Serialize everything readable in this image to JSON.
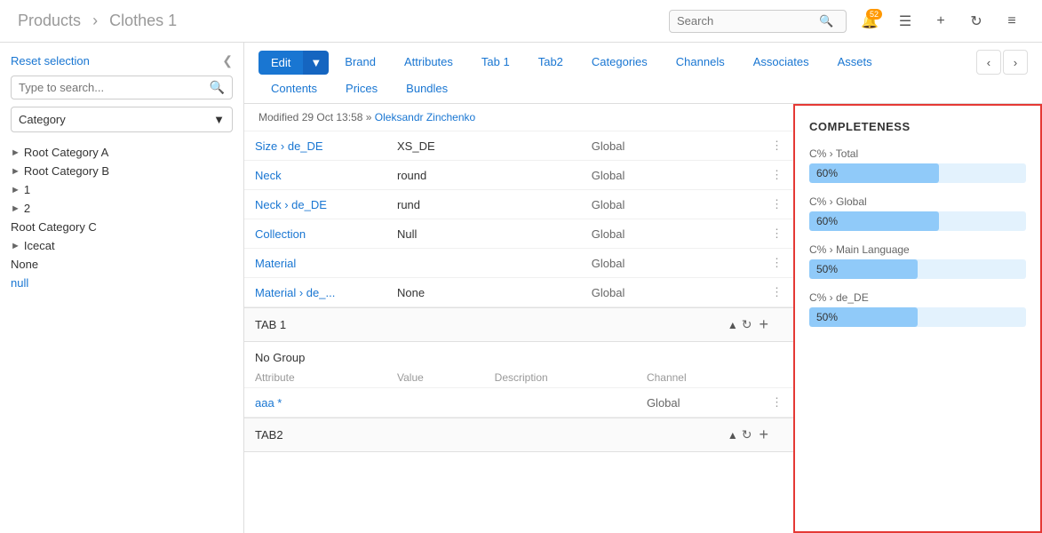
{
  "header": {
    "title": "Products",
    "separator": "›",
    "subtitle": "Clothes 1",
    "search_placeholder": "Search",
    "badge_count": "52"
  },
  "sidebar": {
    "reset_label": "Reset selection",
    "search_placeholder": "Type to search...",
    "dropdown_label": "Category",
    "tree_items": [
      {
        "label": "Root Category A",
        "has_children": true
      },
      {
        "label": "Root Category B",
        "has_children": true
      },
      {
        "label": "1",
        "has_children": true
      },
      {
        "label": "2",
        "has_children": true
      },
      {
        "label": "Root Category C",
        "has_children": false
      },
      {
        "label": "Icecat",
        "has_children": true
      },
      {
        "label": "None",
        "has_children": false
      },
      {
        "label": "null",
        "has_children": false,
        "is_link": true
      }
    ]
  },
  "tabs": {
    "edit_label": "Edit",
    "items": [
      {
        "label": "Brand",
        "active": false
      },
      {
        "label": "Attributes",
        "active": false
      },
      {
        "label": "Tab 1",
        "active": false
      },
      {
        "label": "Tab2",
        "active": false
      },
      {
        "label": "Categories",
        "active": false
      },
      {
        "label": "Channels",
        "active": false
      },
      {
        "label": "Associates",
        "active": false
      },
      {
        "label": "Assets",
        "active": false
      }
    ],
    "row2": [
      {
        "label": "Contents"
      },
      {
        "label": "Prices"
      },
      {
        "label": "Bundles"
      }
    ]
  },
  "modified": {
    "label": "Modified",
    "date": "29 Oct 13:58",
    "arrow": "»",
    "user": "Oleksandr Zinchenko"
  },
  "attributes": [
    {
      "name": "Size › de_DE",
      "value": "XS_DE",
      "scope": "Global"
    },
    {
      "name": "Neck",
      "value": "round",
      "scope": "Global"
    },
    {
      "name": "Neck › de_DE",
      "value": "rund",
      "scope": "Global"
    },
    {
      "name": "Collection",
      "value": "Null",
      "scope": "Global"
    },
    {
      "name": "Material",
      "value": "",
      "scope": "Global"
    },
    {
      "name": "Material › de_...",
      "value": "None",
      "scope": "Global"
    }
  ],
  "tab1_section": {
    "title": "TAB 1",
    "no_group": "No Group",
    "columns": [
      "Attribute",
      "Value",
      "Description",
      "Channel"
    ],
    "rows": [
      {
        "name": "aaa *",
        "value": "",
        "description": "",
        "channel": "Global"
      }
    ]
  },
  "tab2_section": {
    "title": "TAB2"
  },
  "completeness": {
    "title": "COMPLETENESS",
    "items": [
      {
        "label": "C% › Total",
        "percent": 60
      },
      {
        "label": "C% › Global",
        "percent": 60
      },
      {
        "label": "C% › Main Language",
        "percent": 50
      },
      {
        "label": "C% › de_DE",
        "percent": 50
      }
    ]
  }
}
